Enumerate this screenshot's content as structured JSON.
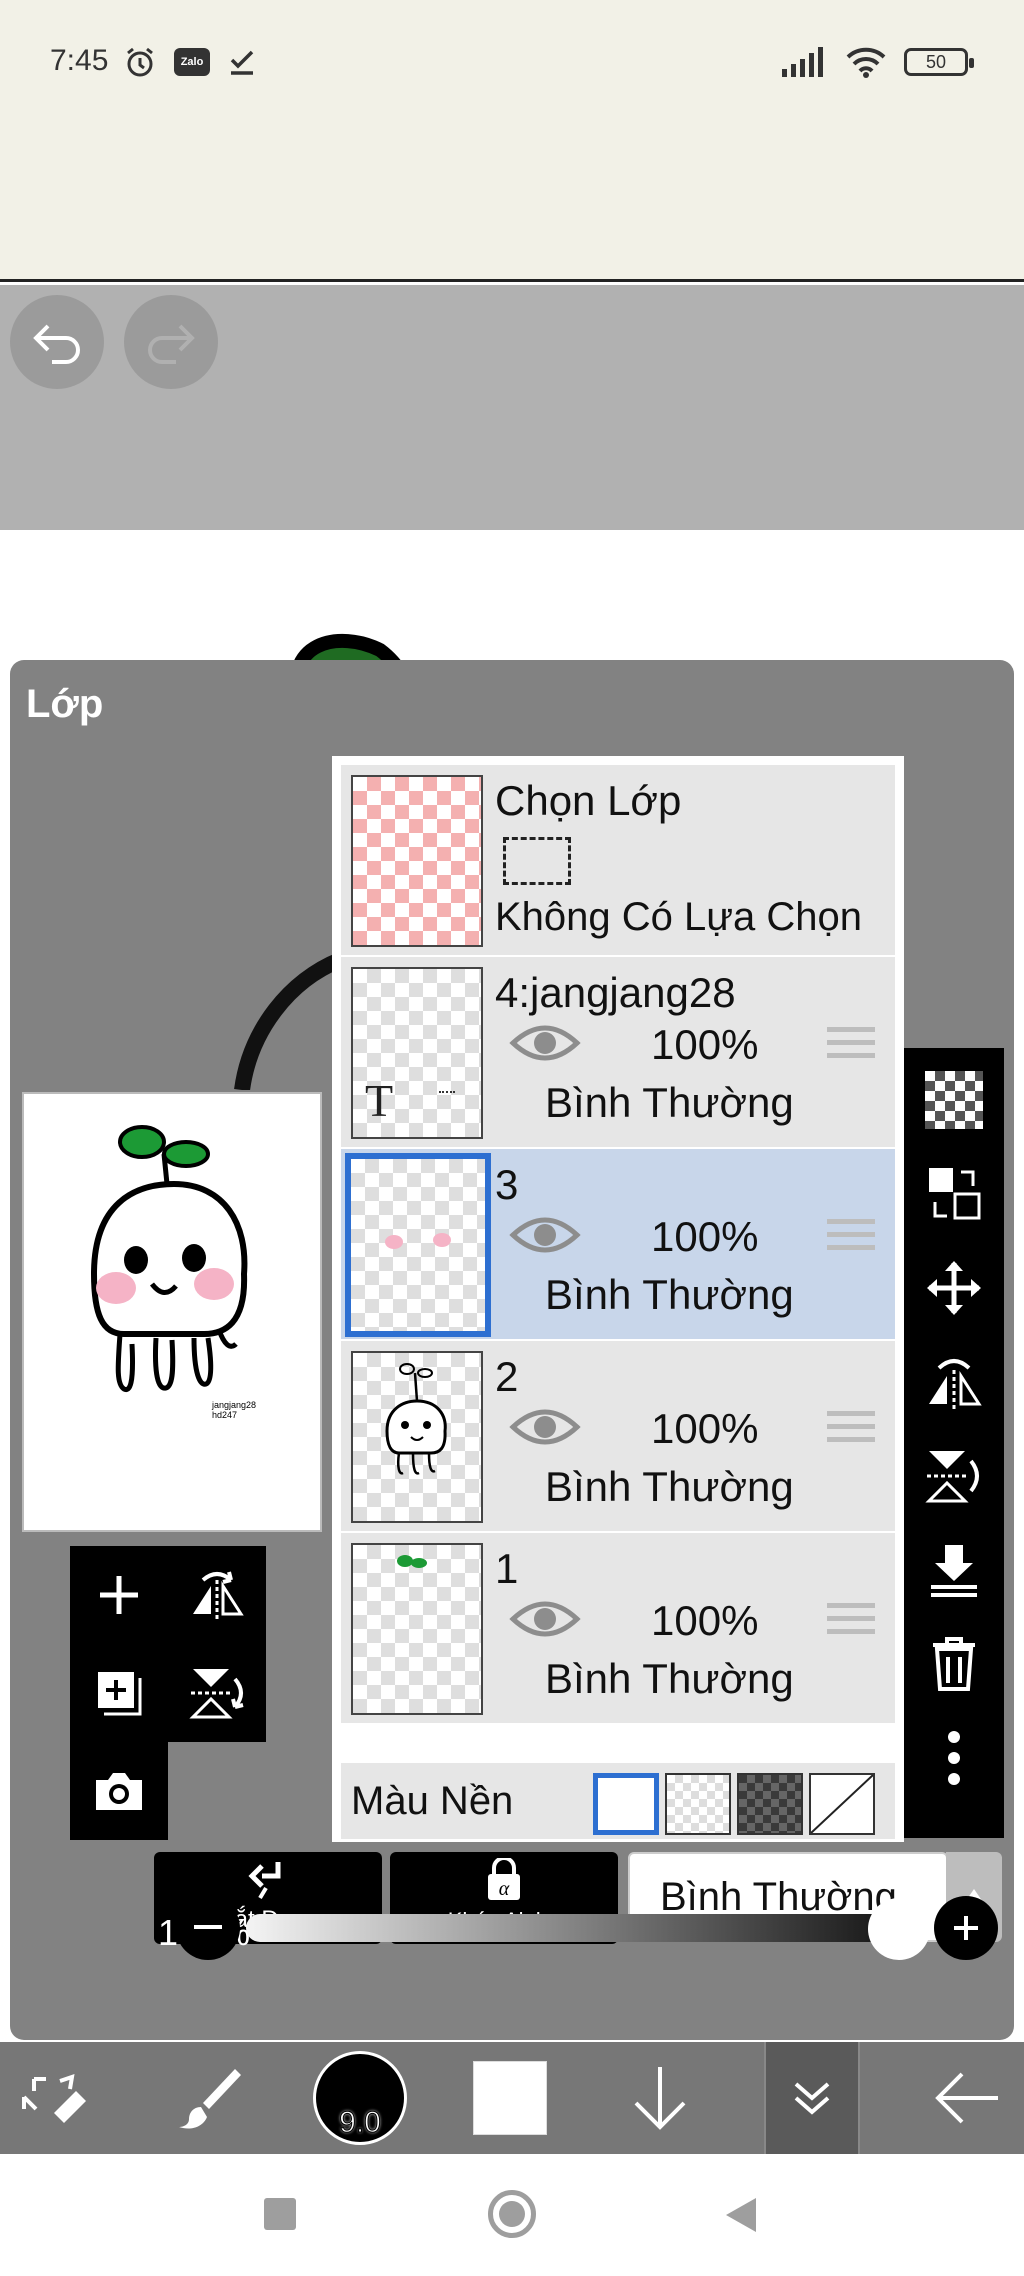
{
  "status_bar": {
    "time": "7:45",
    "zalo_label": "Zalo",
    "battery": "50"
  },
  "toolbar": {
    "undo_icon": "undo-icon",
    "redo_icon": "redo-icon"
  },
  "panel": {
    "title": "Lớp",
    "preview_text_line1": "jangjang28",
    "preview_text_line2": "hd247"
  },
  "selection_layer": {
    "title": "Chọn Lớp",
    "status": "Không Có Lựa Chọn"
  },
  "layers": [
    {
      "name": "4:jangjang28",
      "opacity": "100%",
      "blend": "Bình Thường",
      "thumb_letter": "T",
      "selected": false
    },
    {
      "name": "3",
      "opacity": "100%",
      "blend": "Bình Thường",
      "selected": true
    },
    {
      "name": "2",
      "opacity": "100%",
      "blend": "Bình Thường",
      "selected": false
    },
    {
      "name": "1",
      "opacity": "100%",
      "blend": "Bình Thường",
      "selected": false
    }
  ],
  "background": {
    "label": "Màu Nền",
    "options": [
      "white",
      "transparent",
      "dark-checker",
      "none"
    ],
    "selected": "white"
  },
  "bottom_controls": {
    "clip_label": "Cắt Đoạn",
    "alpha_lock_label": "Khóa Alpha",
    "blend_mode": "Bình Thường",
    "opacity": "100%",
    "opacity_value": 1.0
  },
  "bottom_toolbar": {
    "brush_size": "9.0"
  },
  "colors": {
    "accent": "#2d6fd1",
    "selected_row": "#c8d6ea",
    "panel_bg": "#828282",
    "leaf_green": "#1f6b22",
    "blush_pink": "#f5b3c6"
  }
}
